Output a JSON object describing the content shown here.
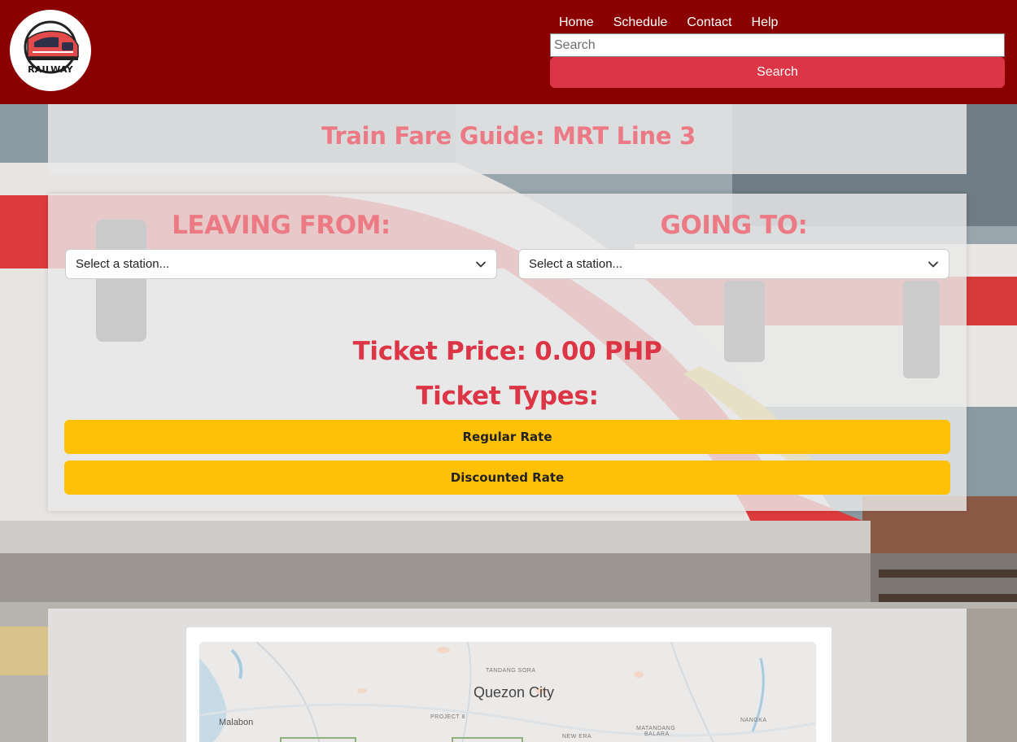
{
  "app": {
    "logo_text": "RAILWAY"
  },
  "nav": {
    "items": [
      "Home",
      "Schedule",
      "Contact",
      "Help"
    ]
  },
  "search": {
    "placeholder": "Search",
    "button_label": "Search"
  },
  "page": {
    "title": "Train Fare Guide: MRT Line 3"
  },
  "fare": {
    "leaving_label": "LEAVING FROM:",
    "going_label": "GOING TO:",
    "leaving_select_value": "Select a station...",
    "going_select_value": "Select a station...",
    "ticket_price_text": "Ticket Price: 0.00 PHP",
    "ticket_types_title": "Ticket Types:",
    "regular_rate_label": "Regular Rate",
    "discounted_rate_label": "Discounted Rate"
  },
  "map": {
    "city": "Quezon City",
    "place_malabon": "Malabon",
    "place_tandang_sora": "TANDANG SORA",
    "place_project8": "PROJECT 8",
    "place_new_era": "NEW ERA",
    "place_matandang_balara_1": "MATANDANG",
    "place_matandang_balara_2": "BALARA",
    "place_nangka": "NANGKA"
  },
  "colors": {
    "header_bg": "#8b0000",
    "search_button": "#dc3545",
    "accent_text": "#dc3545",
    "faded_title": "#ec7a85",
    "rate_button": "#ffc107"
  },
  "icons": {
    "logo": "train-logo-icon",
    "dropdown": "chevron-down-icon"
  }
}
